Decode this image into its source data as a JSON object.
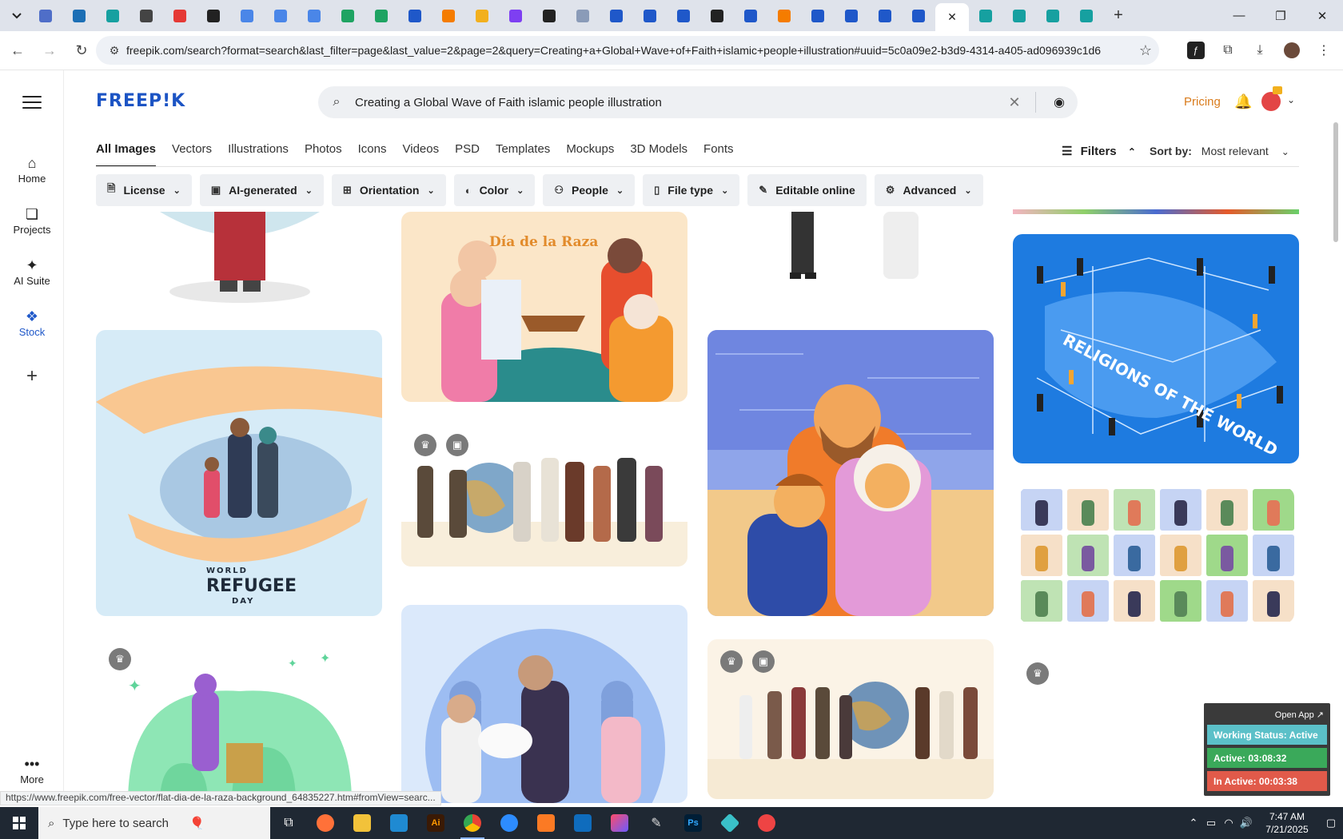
{
  "browser": {
    "url": "freepik.com/search?format=search&last_filter=page&last_value=2&page=2&query=Creating+a+Global+Wave+of+Faith+islamic+people+illustration#uuid=5c0a09e2-b3d9-4314-a405-ad096939c1d6",
    "tab_favicon_colors": [
      "#4f6ec8",
      "#1c6fb5",
      "#16a0a0",
      "#444444",
      "#e53935",
      "#222222",
      "#4a86e8",
      "#4a86e8",
      "#4a86e8",
      "#1ea362",
      "#1ea362",
      "#1f58c9",
      "#f57c00",
      "#f2b01e",
      "#7e3ff2",
      "#222222",
      "#8a9bb8",
      "#1f58c9",
      "#1f58c9",
      "#1f58c9",
      "#222222",
      "#1f58c9",
      "#f57c00",
      "#1f58c9",
      "#1f58c9",
      "#1f58c9",
      "#1f58c9",
      "#1f58c9",
      "#16a0a0",
      "#16a0a0",
      "#16a0a0",
      "#16a0a0"
    ]
  },
  "sidebar": {
    "items": [
      {
        "label": "Home",
        "icon": "home-icon"
      },
      {
        "label": "Projects",
        "icon": "projects-icon"
      },
      {
        "label": "AI Suite",
        "icon": "sparkle-icon"
      },
      {
        "label": "Stock",
        "icon": "stock-icon"
      }
    ],
    "more_label": "More"
  },
  "header": {
    "logo": "FREEP!K",
    "search_value": "Creating a Global Wave of Faith islamic people illustration",
    "pricing": "Pricing"
  },
  "categories": [
    "All Images",
    "Vectors",
    "Illustrations",
    "Photos",
    "Icons",
    "Videos",
    "PSD",
    "Templates",
    "Mockups",
    "3D Models",
    "Fonts"
  ],
  "filters_label": "Filters",
  "sort": {
    "label": "Sort by:",
    "value": "Most relevant"
  },
  "chips": [
    {
      "label": "License",
      "icon": "license-icon"
    },
    {
      "label": "AI-generated",
      "icon": "ai-icon"
    },
    {
      "label": "Orientation",
      "icon": "orientation-icon"
    },
    {
      "label": "Color",
      "icon": "palette-icon"
    },
    {
      "label": "People",
      "icon": "people-icon"
    },
    {
      "label": "File type",
      "icon": "file-icon"
    },
    {
      "label": "Editable online",
      "icon": "pencil-icon"
    },
    {
      "label": "Advanced",
      "icon": "gear-icon"
    }
  ],
  "cards": {
    "raza_title": "Día de la Raza",
    "refugee_line1": "WORLD",
    "refugee_line2": "REFUGEE",
    "refugee_line3": "DAY",
    "religions_title": "RELIGIONS OF THE WORLD"
  },
  "widget": {
    "open_app": "Open App ↗",
    "status": "Working Status: Active",
    "active": "Active: 03:08:32",
    "inactive": "In Active: 00:03:38",
    "colors": {
      "status": "#5bc0c8",
      "active": "#3aa95a",
      "inactive": "#e15a4a"
    }
  },
  "status_url": "https://www.freepik.com/free-vector/flat-dia-de-la-raza-background_64835227.htm#fromView=searc...",
  "taskbar": {
    "search_placeholder": "Type here to search",
    "time": "7:47 AM",
    "date": "7/21/2025"
  }
}
